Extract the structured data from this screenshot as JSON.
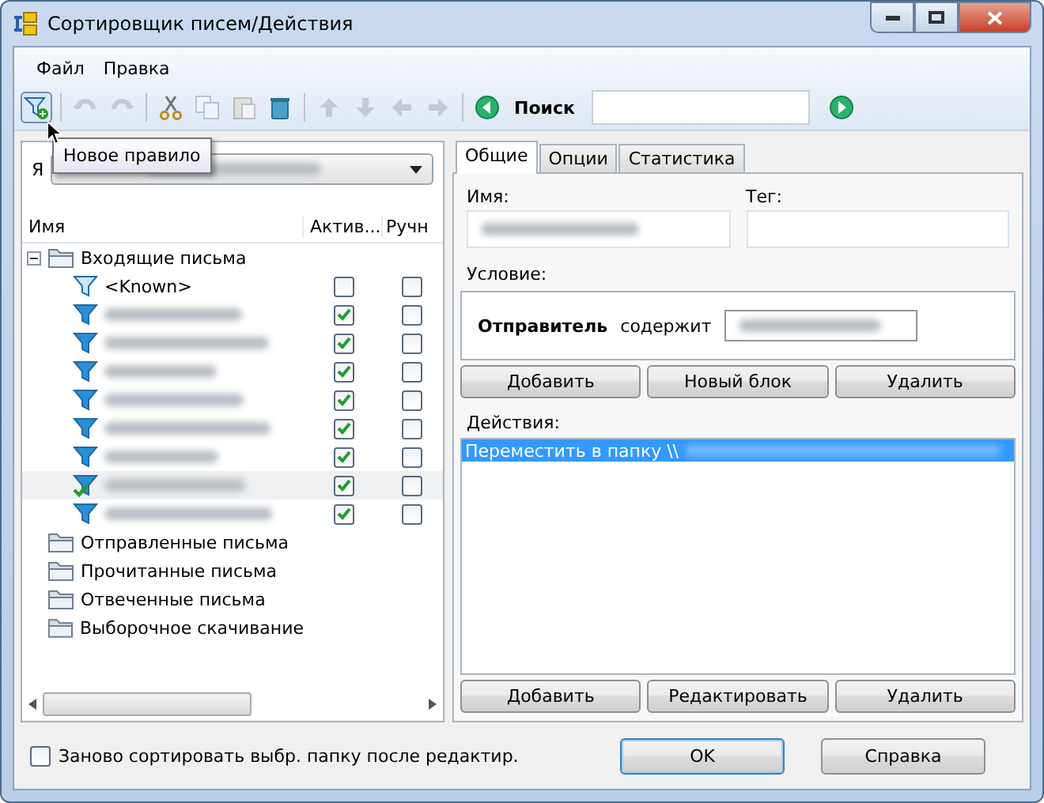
{
  "window": {
    "title": "Сортировщик писем/Действия"
  },
  "menu": [
    {
      "label": "Файл"
    },
    {
      "label": "Правка"
    }
  ],
  "toolbar": {
    "tooltip": "Новое правило",
    "search_label": "Поиск"
  },
  "account": {
    "label": "Я"
  },
  "tree": {
    "columns": [
      "Имя",
      "Актив...",
      "Ручн"
    ],
    "folders": [
      {
        "name": "Входящие письма",
        "expanded": true,
        "children": [
          {
            "name": "<Known>",
            "active": false,
            "manual": false,
            "selected": false,
            "marked": false
          },
          {
            "active": true,
            "manual": false,
            "selected": false,
            "marked": false
          },
          {
            "active": true,
            "manual": false,
            "selected": false,
            "marked": false
          },
          {
            "active": true,
            "manual": false,
            "selected": false,
            "marked": false
          },
          {
            "active": true,
            "manual": false,
            "selected": false,
            "marked": false
          },
          {
            "active": true,
            "manual": false,
            "selected": false,
            "marked": false
          },
          {
            "active": true,
            "manual": false,
            "selected": false,
            "marked": false
          },
          {
            "active": true,
            "manual": false,
            "selected": true,
            "marked": true
          },
          {
            "active": true,
            "manual": false,
            "selected": false,
            "marked": false
          }
        ]
      },
      {
        "name": "Отправленные письма"
      },
      {
        "name": "Прочитанные письма"
      },
      {
        "name": "Отвеченные письма"
      },
      {
        "name": "Выборочное скачивание"
      }
    ]
  },
  "tabs": [
    {
      "label": "Общие",
      "selected": true
    },
    {
      "label": "Опции",
      "selected": false
    },
    {
      "label": "Статистика",
      "selected": false
    }
  ],
  "general": {
    "name_label": "Имя:",
    "tag_label": "Тег:",
    "condition_label": "Условие:",
    "condition": {
      "field": "Отправитель",
      "operator": "содержит"
    },
    "condition_buttons": [
      "Добавить",
      "Новый блок",
      "Удалить"
    ],
    "actions_label": "Действия:",
    "actions": [
      {
        "text": "Переместить в папку \\\\",
        "selected": true
      }
    ],
    "action_buttons": [
      "Добавить",
      "Редактировать",
      "Удалить"
    ]
  },
  "footer": {
    "checkbox": {
      "label": "Заново сортировать выбр. папку после редактир.",
      "checked": false
    },
    "buttons": [
      {
        "label": "OK",
        "default": true
      },
      {
        "label": "Справка",
        "default": false
      }
    ]
  }
}
